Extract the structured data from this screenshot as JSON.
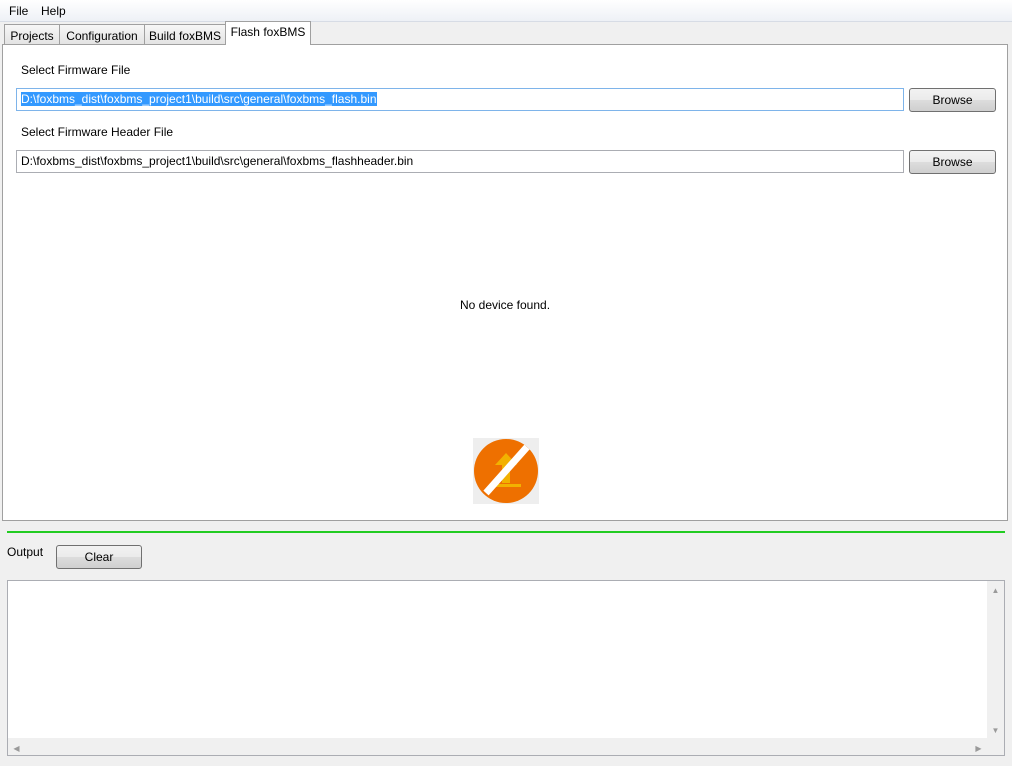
{
  "menu": {
    "file": "File",
    "help": "Help"
  },
  "tabs": [
    {
      "label": "Projects"
    },
    {
      "label": "Configuration"
    },
    {
      "label": "Build foxBMS"
    },
    {
      "label": "Flash foxBMS",
      "active": true
    }
  ],
  "flash": {
    "firmware_label": "Select Firmware File",
    "firmware_path": "D:\\foxbms_dist\\foxbms_project1\\build\\src\\general\\foxbms_flash.bin",
    "header_label": "Select Firmware Header File",
    "header_path": "D:\\foxbms_dist\\foxbms_project1\\build\\src\\general\\foxbms_flashheader.bin",
    "browse_label": "Browse",
    "status": "No device found.",
    "icon": "flash-disabled-icon"
  },
  "output": {
    "label": "Output",
    "clear_label": "Clear",
    "text": ""
  },
  "colors": {
    "accent_orange": "#ee7000",
    "splitter_green": "#22cc22",
    "selection_blue": "#3399ff"
  }
}
